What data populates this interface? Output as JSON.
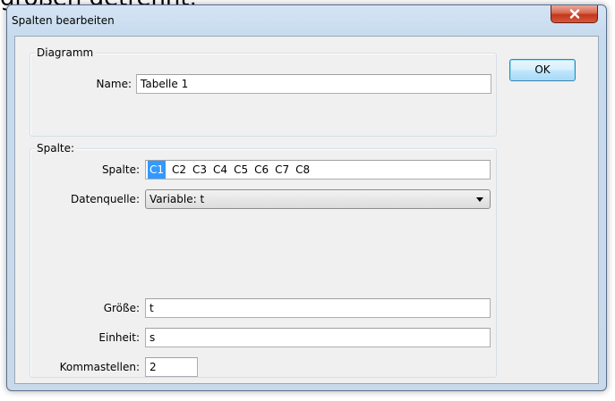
{
  "background": {
    "caption": "größen getrennt."
  },
  "window": {
    "title": "Spalten bearbeiten",
    "close_glyph": "✕"
  },
  "diagram_group": {
    "label": "Diagramm",
    "name_label": "Name:",
    "name_value": "Tabelle 1"
  },
  "column_group": {
    "label": "Spalte:",
    "column_label": "Spalte:",
    "columns": [
      "C1",
      "C2",
      "C3",
      "C4",
      "C5",
      "C6",
      "C7",
      "C8"
    ],
    "selected_column": "C1",
    "source_label": "Datenquelle:",
    "source_value": "Variable: t",
    "quantity_label": "Größe:",
    "quantity_value": "t",
    "unit_label": "Einheit:",
    "unit_value": "s",
    "decimals_label": "Kommastellen:",
    "decimals_value": "2"
  },
  "buttons": {
    "ok_label": "OK"
  },
  "colors": {
    "selection": "#3399ff",
    "close_button": "#c0381c"
  }
}
